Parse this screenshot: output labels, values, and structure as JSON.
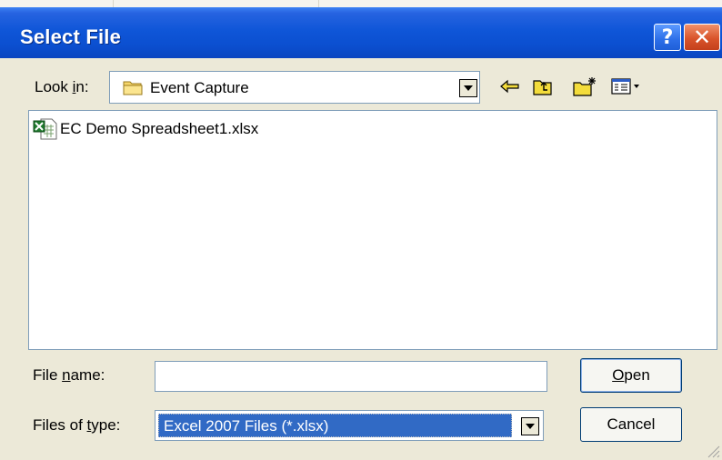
{
  "dialog": {
    "title": "Select File",
    "help_glyph": "?",
    "close_glyph": "✕"
  },
  "lookin": {
    "label_pre": "Look ",
    "label_accel": "i",
    "label_post": "n:",
    "value": "Event Capture",
    "icon": "folder-icon"
  },
  "toolbar": {
    "icons": [
      "back-arrow-icon",
      "up-one-level-icon",
      "create-new-folder-icon",
      "view-menu-icon"
    ]
  },
  "files": [
    {
      "name": "EC Demo Spreadsheet1.xlsx",
      "icon": "excel-file-icon"
    }
  ],
  "filename": {
    "label_pre": "File ",
    "label_accel": "n",
    "label_post": "ame:",
    "value": ""
  },
  "filetype": {
    "label_pre": "Files of ",
    "label_accel": "t",
    "label_post": "ype:",
    "value": "Excel 2007 Files (*.xlsx)"
  },
  "buttons": {
    "open_accel": "O",
    "open_rest": "pen",
    "cancel": "Cancel"
  },
  "colors": {
    "titlebar": "#0b4fd0",
    "selection": "#316ac5",
    "face": "#ece9d8",
    "close_button": "#d9542b"
  }
}
